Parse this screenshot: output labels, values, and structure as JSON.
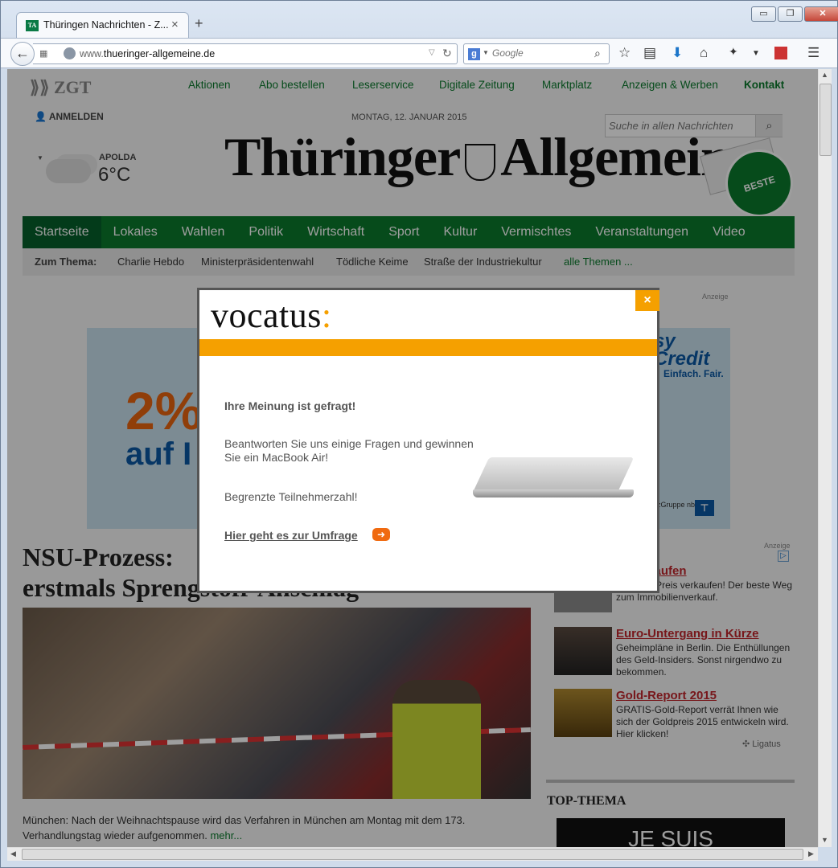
{
  "browser": {
    "tab_title": "Thüringen Nachrichten - Z...",
    "tab_favicon": "TA",
    "url_prefix": "www.",
    "url_domain": "thueringer-allgemeine.de",
    "search_placeholder": "Google",
    "win_minimize": "▭",
    "win_restore": "❐",
    "win_close": "✕"
  },
  "header": {
    "publisher_logo": "ZGT",
    "topnav": [
      "Aktionen",
      "Abo bestellen",
      "Leserservice",
      "Digitale Zeitung",
      "Marktplatz",
      "Anzeigen & Werben",
      "Kontakt"
    ],
    "login_label": "ANMELDEN",
    "date": "MONTAG, 12. JANUAR 2015",
    "search_placeholder": "Suche in allen Nachrichten",
    "weather_city": "APOLDA",
    "weather_temp": "6°C",
    "masthead_left": "Thüringer",
    "masthead_right": "Allgemeine",
    "badge_text": "BESTE"
  },
  "mainnav": [
    "Startseite",
    "Lokales",
    "Wahlen",
    "Politik",
    "Wirtschaft",
    "Sport",
    "Kultur",
    "Vermischtes",
    "Veranstaltungen",
    "Video"
  ],
  "subnav": {
    "label": "Zum Thema:",
    "items": [
      "Charlie Hebdo",
      "Ministerpräsidentenwahl",
      "Tödliche Keime",
      "Straße der Industriekultur"
    ],
    "more": "alle Themen ..."
  },
  "ad_label": "Anzeige",
  "banner": {
    "percent": "2%",
    "line2": "auf I",
    "easy": "sy",
    "credit": "Credit",
    "slogan": "Einfach. Fair.",
    "footer": "zGruppe nbanken"
  },
  "article": {
    "headline_1": "NSU-Prozess:",
    "headline_2": "erstmals Sprengstoff-Anschlag",
    "caption": "München: Nach der Weihnachtspause wird das Verfahren in München am Montag mit dem 173. Verhandlungstag wieder aufgenommen.",
    "more": "mehr..."
  },
  "ads": [
    {
      "title": "ie verkaufen",
      "text": "zum Top-Preis verkaufen! Der beste Weg zum Immobilienverkauf."
    },
    {
      "title": "Euro-Untergang in Kürze",
      "text": "Geheimpläne in Berlin. Die Enthüllungen des Geld-Insiders. Sonst nirgendwo zu bekommen."
    },
    {
      "title": "Gold-Report 2015",
      "text": "GRATIS-Gold-Report verrät Ihnen wie sich der Goldpreis 2015 entwickeln wird. Hier klicken!"
    }
  ],
  "ads_provider": "Ligatus",
  "top_thema": {
    "title": "TOP-THEMA",
    "image_text": "JE SUIS"
  },
  "modal": {
    "brand": "vocatus",
    "brand_colon": ":",
    "question": "Ihre Meinung ist gefragt!",
    "text1": "Beantworten Sie uns einige Fragen und gewinnen Sie ein MacBook Air!",
    "text2": "Begrenzte Teilnehmerzahl!",
    "link": "Hier geht es zur Umfrage",
    "close": "×",
    "arrow": "➜"
  },
  "colors": {
    "accent": "#0a7a2c",
    "modal_accent": "#f5a000",
    "ad_title": "#c0262d"
  }
}
